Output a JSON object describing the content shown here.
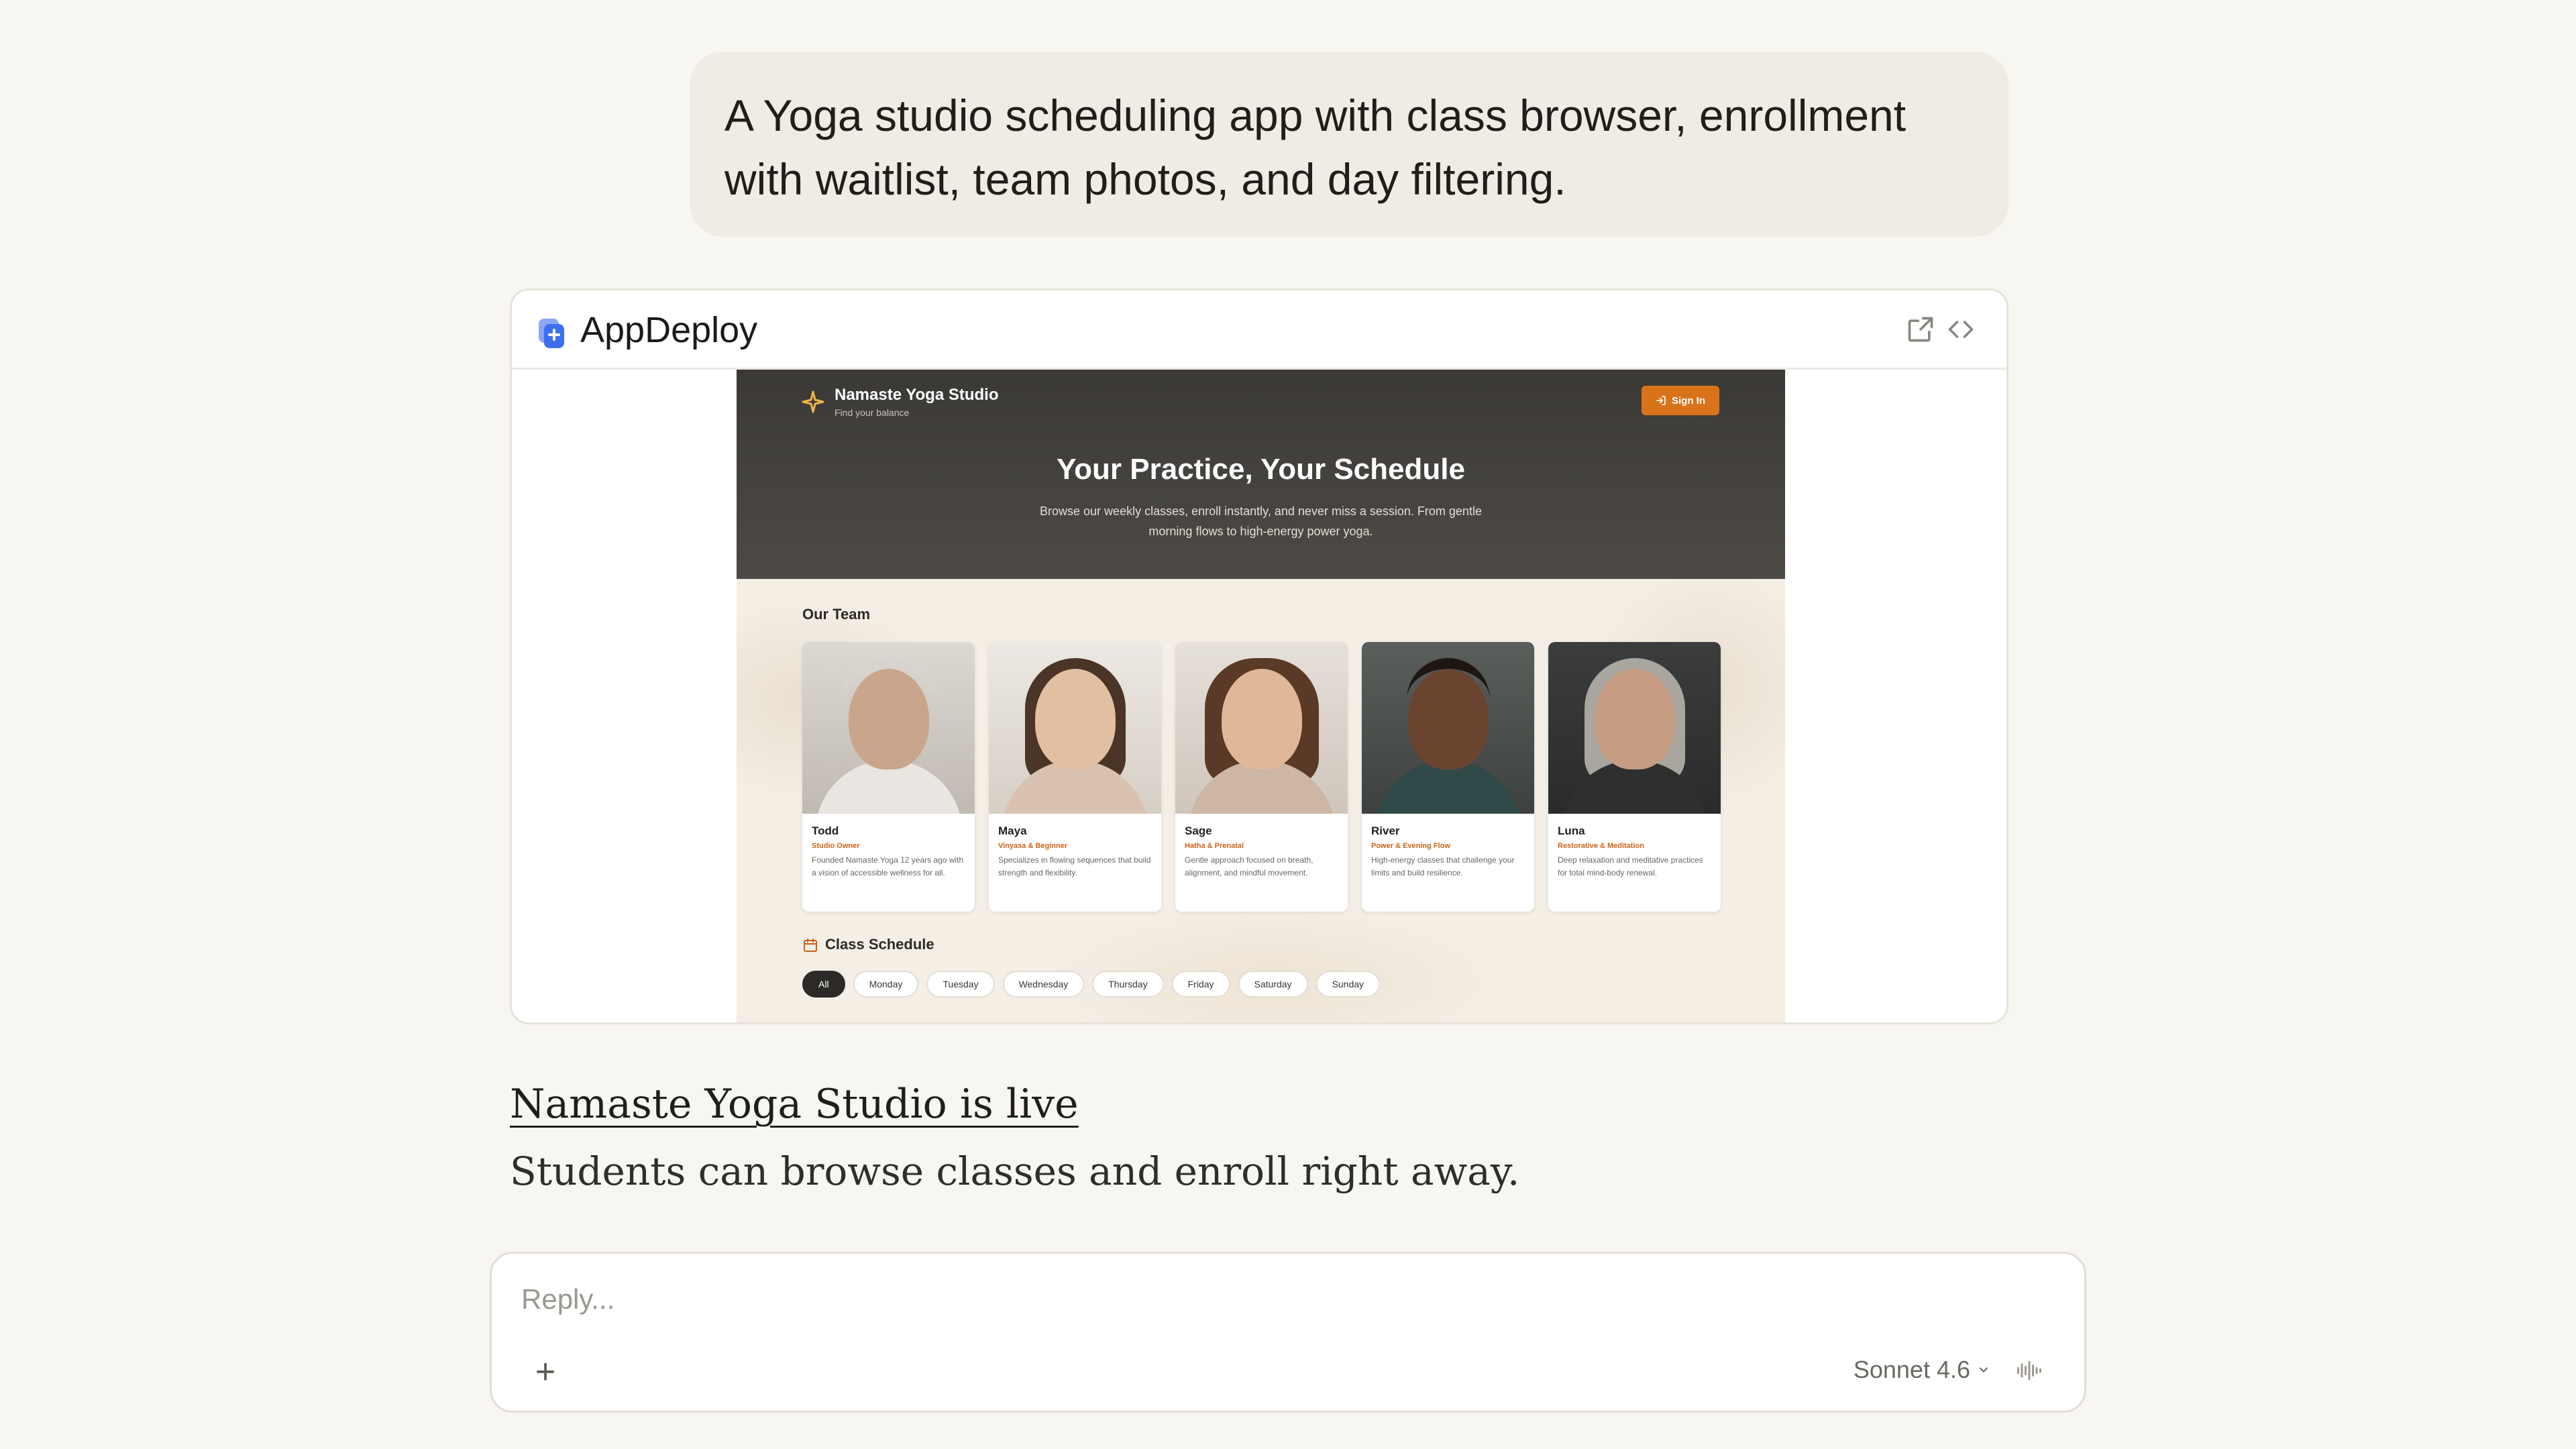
{
  "user_message": "A Yoga studio scheduling app with class browser, enrollment with waitlist, team photos, and day filtering.",
  "artifact": {
    "title": "AppDeploy",
    "open_icon": "external-link-icon",
    "code_icon": "code-icon"
  },
  "app": {
    "brand_name": "Namaste Yoga Studio",
    "brand_tagline": "Find your balance",
    "signin_label": "Sign In",
    "hero_title": "Your Practice, Your Schedule",
    "hero_subtitle": "Browse our weekly classes, enroll instantly, and never miss a session. From gentle morning flows to high-energy power yoga.",
    "team_heading": "Our Team",
    "team": [
      {
        "name": "Todd",
        "role": "Studio Owner",
        "desc": "Founded Namaste Yoga 12 years ago with a vision of accessible wellness for all."
      },
      {
        "name": "Maya",
        "role": "Vinyasa & Beginner",
        "desc": "Specializes in flowing sequences that build strength and flexibility."
      },
      {
        "name": "Sage",
        "role": "Hatha & Prenatal",
        "desc": "Gentle approach focused on breath, alignment, and mindful movement."
      },
      {
        "name": "River",
        "role": "Power & Evening Flow",
        "desc": "High-energy classes that challenge your limits and build resilience."
      },
      {
        "name": "Luna",
        "role": "Restorative & Meditation",
        "desc": "Deep relaxation and meditative practices for total mind-body renewal."
      }
    ],
    "schedule_heading": "Class Schedule",
    "days": [
      "All",
      "Monday",
      "Tuesday",
      "Wednesday",
      "Thursday",
      "Friday",
      "Saturday",
      "Sunday"
    ],
    "active_day": "All"
  },
  "assistant": {
    "title": "Namaste Yoga Studio is live",
    "body": "Students can browse classes and enroll right away."
  },
  "composer": {
    "placeholder": "Reply...",
    "model": "Sonnet 4.6"
  }
}
